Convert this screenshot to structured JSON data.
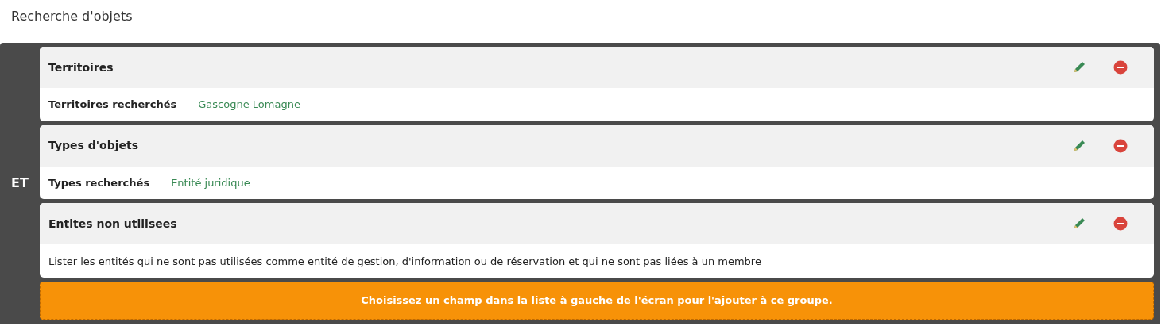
{
  "title": "Recherche d'objets",
  "group": {
    "operator": "ET",
    "criteria": [
      {
        "title": "Territoires",
        "kind": "field",
        "label": "Territoires recherchés",
        "value": "Gascogne Lomagne"
      },
      {
        "title": "Types d'objets",
        "kind": "field",
        "label": "Types recherchés",
        "value": "Entité juridique"
      },
      {
        "title": "Entites non utilisees",
        "kind": "description",
        "text": "Lister les entités qui ne sont pas utilisées comme entité de gestion, d'information ou de réservation et qui ne sont pas liées à un membre"
      }
    ],
    "drop_zone": "Choisissez un champ dans la liste à gauche de l'écran pour l'ajouter à ce groupe."
  }
}
